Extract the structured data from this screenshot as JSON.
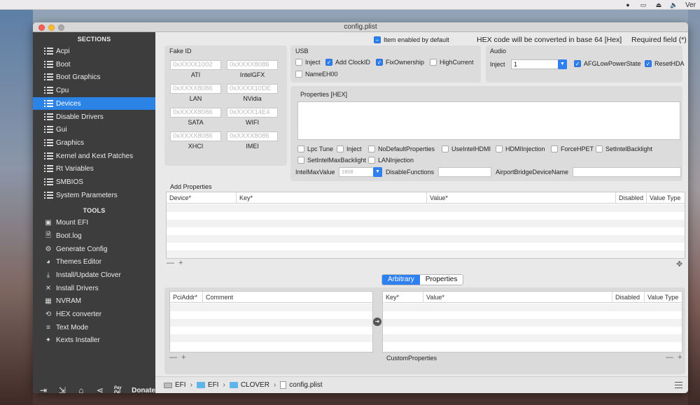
{
  "menubar": {
    "right_text": "Ver"
  },
  "window": {
    "title": "config.plist"
  },
  "sidebar": {
    "sections_heading": "SECTIONS",
    "sections": [
      {
        "label": "Acpi"
      },
      {
        "label": "Boot"
      },
      {
        "label": "Boot Graphics"
      },
      {
        "label": "Cpu"
      },
      {
        "label": "Devices"
      },
      {
        "label": "Disable Drivers"
      },
      {
        "label": "Gui"
      },
      {
        "label": "Graphics"
      },
      {
        "label": "Kernel and Kext Patches"
      },
      {
        "label": "Rt Variables"
      },
      {
        "label": "SMBIOS"
      },
      {
        "label": "System Parameters"
      }
    ],
    "active_section": "Devices",
    "tools_heading": "TOOLS",
    "tools": [
      {
        "label": "Mount EFI"
      },
      {
        "label": "Boot.log"
      },
      {
        "label": "Generate Config"
      },
      {
        "label": "Themes Editor"
      },
      {
        "label": "Install/Update Clover"
      },
      {
        "label": "Install Drivers"
      },
      {
        "label": "NVRAM"
      },
      {
        "label": "HEX converter"
      },
      {
        "label": "Text Mode"
      },
      {
        "label": "Kexts Installer"
      }
    ],
    "donate_small": "Pay Pal",
    "donate_label": "Donate"
  },
  "header": {
    "enabled_default": "Item enabled by default",
    "hex_note": "HEX code will be converted in base 64 [Hex]",
    "required_note": "Required field (*)"
  },
  "fake_id": {
    "title": "Fake ID",
    "fields": [
      {
        "placeholder": "0xXXXX1002",
        "label": "ATI"
      },
      {
        "placeholder": "0xXXXX8086",
        "label": "IntelGFX"
      },
      {
        "placeholder": "0xXXXX8086",
        "label": "LAN"
      },
      {
        "placeholder": "0xXXXX10DE",
        "label": "NVidia"
      },
      {
        "placeholder": "0xXXXX8086",
        "label": "SATA"
      },
      {
        "placeholder": "0xXXXX14E4",
        "label": "WIFI"
      },
      {
        "placeholder": "0xXXXX8086",
        "label": "XHCI"
      },
      {
        "placeholder": "0xXXXX8086",
        "label": "IMEI"
      }
    ]
  },
  "usb": {
    "title": "USB",
    "options": [
      {
        "label": "Inject",
        "checked": false
      },
      {
        "label": "Add ClockID",
        "checked": true
      },
      {
        "label": "FixOwnership",
        "checked": true
      },
      {
        "label": "HighCurrent",
        "checked": false
      },
      {
        "label": "NameEH00",
        "checked": false
      }
    ]
  },
  "audio": {
    "title": "Audio",
    "inject_label": "Inject",
    "inject_value": "1",
    "options": [
      {
        "label": "AFGLowPowerState",
        "checked": true
      },
      {
        "label": "ResetHDA",
        "checked": true
      }
    ]
  },
  "properties": {
    "title": "Properties [HEX]",
    "checkboxes": [
      {
        "label": "Lpc Tune",
        "checked": false
      },
      {
        "label": "Inject",
        "checked": false
      },
      {
        "label": "NoDefaultProperties",
        "checked": false
      },
      {
        "label": "UseIntelHDMI",
        "checked": false
      },
      {
        "label": "HDMIInjection",
        "checked": false
      },
      {
        "label": "ForceHPET",
        "checked": false
      },
      {
        "label": "SetIntelBacklight",
        "checked": false
      },
      {
        "label": "SetIntelMaxBacklight",
        "checked": false
      },
      {
        "label": "LANInjection",
        "checked": false
      }
    ],
    "intel_max_value_label": "IntelMaxValue",
    "intel_max_value": "1808",
    "disable_functions_label": "DisableFunctions",
    "airport_label": "AirportBridgeDeviceName"
  },
  "add_properties": {
    "title": "Add Properties",
    "columns": [
      "Device*",
      "Key*",
      "Value*",
      "Disabled",
      "Value Type"
    ]
  },
  "segmented": {
    "arbitrary": "Arbitrary",
    "properties": "Properties"
  },
  "arbitrary_left": {
    "columns": [
      "PciAddr*",
      "Comment"
    ]
  },
  "arbitrary_right": {
    "columns": [
      "Key*",
      "Value*",
      "Disabled",
      "Value Type"
    ],
    "footer": "CustomProperties"
  },
  "controls": {
    "minus": "—",
    "plus": "+"
  },
  "pathbar": {
    "items": [
      "EFI",
      "EFI",
      "CLOVER",
      "config.plist"
    ]
  }
}
